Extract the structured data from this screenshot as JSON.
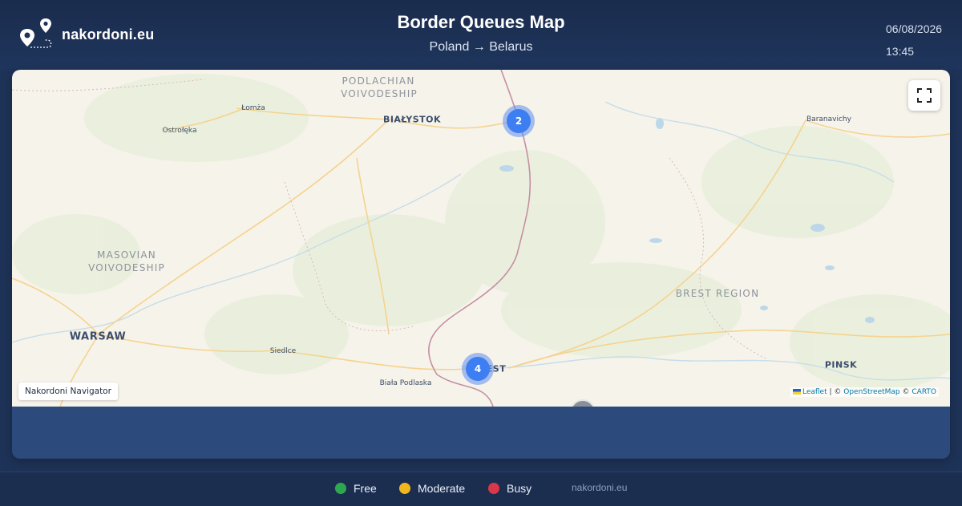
{
  "header": {
    "brand_name": "nakordoni.eu",
    "title": "Border Queues Map",
    "subtitle": "Poland → Belarus",
    "date": "06/08/2026",
    "time": "13:45"
  },
  "map": {
    "places": [
      {
        "name": "PODLACHIAN",
        "kind": "region"
      },
      {
        "name": "VOIVODESHIP",
        "kind": "region"
      },
      {
        "name": "MASOVIAN",
        "kind": "region"
      },
      {
        "name": "VOIVODESHIP",
        "kind": "region"
      },
      {
        "name": "BREST REGION",
        "kind": "region"
      },
      {
        "name": "BIAŁYSTOK",
        "kind": "city"
      },
      {
        "name": "WARSAW",
        "kind": "capital"
      },
      {
        "name": "PINSK",
        "kind": "city"
      },
      {
        "name": "EST",
        "kind": "city"
      },
      {
        "name": "Łomża",
        "kind": "town"
      },
      {
        "name": "Ostrołęka",
        "kind": "town"
      },
      {
        "name": "Baranavichy",
        "kind": "town"
      },
      {
        "name": "Siedlce",
        "kind": "town"
      },
      {
        "name": "Biała Podlaska",
        "kind": "town"
      }
    ],
    "clusters": [
      {
        "count": "2"
      },
      {
        "count": "4"
      }
    ],
    "nav_label": "Nakordoni Navigator",
    "attribution": {
      "leaflet": "Leaflet",
      "sep1": " | © ",
      "osm": "OpenStreetMap",
      "sep2": " © ",
      "carto": "CARTO"
    },
    "fullscreen_icon": "fullscreen-icon",
    "colors": {
      "land": "#f6f3ea",
      "road": "#f5d38f",
      "border": "#c58fa5",
      "water": "#bcd8e8",
      "cluster": "#3d7ef2"
    }
  },
  "legend": {
    "items": [
      {
        "label": "Free",
        "color": "#2ea84f"
      },
      {
        "label": "Moderate",
        "color": "#f0b81c"
      },
      {
        "label": "Busy",
        "color": "#d9374a"
      }
    ],
    "site": "nakordoni.eu"
  }
}
